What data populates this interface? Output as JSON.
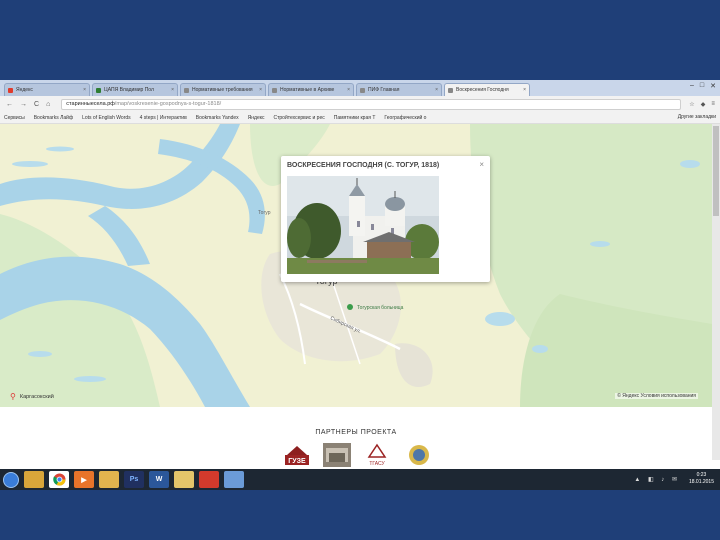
{
  "browser": {
    "tabs": [
      {
        "label": "Яндекс",
        "icon": "yandex-icon",
        "color": "#e03b2c"
      },
      {
        "label": "ЦАПЯ Владимир Пол",
        "icon": "site-icon",
        "color": "#2e7d32"
      },
      {
        "label": "Нормативные требования",
        "icon": "doc-icon",
        "color": "#888888"
      },
      {
        "label": "Нормативные в Архиве",
        "icon": "doc-icon",
        "color": "#888888"
      },
      {
        "label": "ПИФ Главная",
        "icon": "doc-icon",
        "color": "#888888"
      },
      {
        "label": "Воскресения Господня",
        "icon": "doc-icon",
        "color": "#888888"
      }
    ],
    "active_tab_index": 5,
    "address": {
      "domain": "старинныесела.рф",
      "path": "/map/voskresenie-gospodnya-s-togur-1818/"
    },
    "bookmarks": [
      "Сервисы",
      "Bookmarks Лайф",
      "Lots of English Words",
      "4 steps | Интерактив",
      "Bookmarks Yandex",
      "Яндекс",
      "Стройтехсервис и рес",
      "Памятники края Т",
      "Географический о",
      "Другие закладки"
    ],
    "other_bookmarks": "Другие закладки"
  },
  "map": {
    "popup_title": "ВОСКРЕСЕНИЯ ГОСПОДНЯ (С. ТОГУР, 1818)",
    "close_symbol": "×",
    "labels": {
      "town": "Тогур",
      "street": "Сибирская ул.",
      "poi": "Тогурская больница",
      "village": "Тогур"
    },
    "location_label": "Каргасокский",
    "copyright": "© Яндекс  Условия использования"
  },
  "partners": {
    "title": "ПАРТНЕРЫ ПРОЕКТА",
    "logos": [
      "gue-logo",
      "museum-logo",
      "tgasu-logo",
      "emblem-logo"
    ],
    "gue_text": "ГУЗЕ",
    "tgasu_text": "ТГАСУ"
  },
  "taskbar": {
    "apps": [
      {
        "name": "explorer-icon",
        "label": "",
        "color": "#d9a63a"
      },
      {
        "name": "chrome-icon",
        "label": "",
        "color": "#ffffff"
      },
      {
        "name": "media-icon",
        "label": "▶",
        "color": "#e8742a"
      },
      {
        "name": "explorer2-icon",
        "label": "",
        "color": "#e2b44e"
      },
      {
        "name": "photoshop-icon",
        "label": "Ps",
        "color": "#203060"
      },
      {
        "name": "word-icon",
        "label": "W",
        "color": "#2b579a"
      },
      {
        "name": "files-icon",
        "label": "",
        "color": "#e4c56a"
      },
      {
        "name": "pdf-icon",
        "label": "",
        "color": "#d33a2c"
      },
      {
        "name": "paint-icon",
        "label": "",
        "color": "#6b9bd8"
      }
    ],
    "time": "0:23",
    "date": "18.01.2015"
  }
}
